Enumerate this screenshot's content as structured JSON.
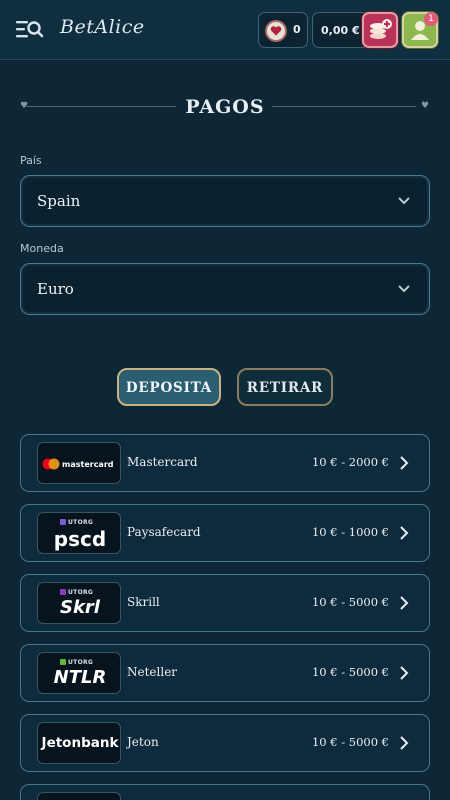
{
  "header": {
    "logo_text": "BetAlice",
    "hearts_count": "0",
    "balance": "0,00 €",
    "notification_count": "1"
  },
  "page": {
    "title": "PAGOS"
  },
  "form": {
    "country_label": "País",
    "country_value": "Spain",
    "currency_label": "Moneda",
    "currency_value": "Euro"
  },
  "tabs": {
    "deposit": "DEPOSITA",
    "withdraw": "RETIRAR"
  },
  "methods": [
    {
      "name": "Mastercard",
      "range": "10 € - 2000 €",
      "logo": "mastercard"
    },
    {
      "name": "Paysafecard",
      "range": "10 € - 1000 €",
      "logo": "pscd",
      "badge": "UTORG"
    },
    {
      "name": "Skrill",
      "range": "10 € - 5000 €",
      "logo": "Skrl",
      "badge": "UTORG"
    },
    {
      "name": "Neteller",
      "range": "10 € - 5000 €",
      "logo": "NTLR",
      "badge": "UTORG"
    },
    {
      "name": "Jeton",
      "range": "10 € - 5000 €",
      "logo": "Jetonbank"
    }
  ],
  "colors": {
    "background": "#0d2737",
    "accent_gold": "#c9b27e",
    "deposit_button": "#b8325a",
    "profile_button": "#8cb84e"
  }
}
